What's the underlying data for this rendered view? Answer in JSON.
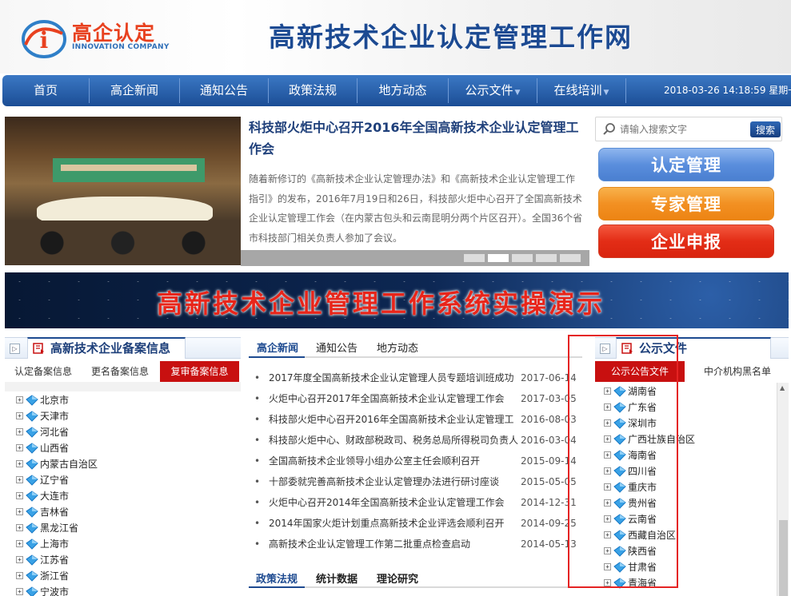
{
  "logo": {
    "name": "高企认定",
    "en": "INNOVATION COMPANY"
  },
  "site_title": "高新技术企业认定管理工作网",
  "nav": {
    "items": [
      {
        "label": "首页",
        "dropdown": false
      },
      {
        "label": "高企新闻",
        "dropdown": false
      },
      {
        "label": "通知公告",
        "dropdown": false
      },
      {
        "label": "政策法规",
        "dropdown": false
      },
      {
        "label": "地方动态",
        "dropdown": false
      },
      {
        "label": "公示文件",
        "dropdown": true
      },
      {
        "label": "在线培训",
        "dropdown": true
      }
    ],
    "datetime": "2018-03-26 14:18:59 星期一"
  },
  "slide": {
    "title": "科技部火炬中心召开2016年全国高新技术企业认定管理工作会",
    "description": "随着新修订的《高新技术企业认定管理办法》和《高新技术企业认定管理工作指引》的发布，2016年7月19日和26日，科技部火炬中心召开了全国高新技术企业认定管理工作会（在内蒙古包头和云南昆明分两个片区召开）。全国36个省市科技部门相关负责人参加了会议。",
    "dots": 5,
    "active_dot": 2
  },
  "search": {
    "placeholder": "请输入搜索文字",
    "button": "搜索"
  },
  "big_buttons": {
    "rd": "认定管理",
    "zj": "专家管理",
    "qy": "企业申报"
  },
  "banner": {
    "title": "高新技术企业管理工作系统实操演示"
  },
  "left_panel": {
    "title": "高新技术企业备案信息",
    "subtabs": [
      "认定备案信息",
      "更名备案信息",
      "复审备案信息"
    ],
    "active_subtab": 2,
    "items": [
      "北京市",
      "天津市",
      "河北省",
      "山西省",
      "内蒙古自治区",
      "辽宁省",
      "大连市",
      "吉林省",
      "黑龙江省",
      "上海市",
      "江苏省",
      "浙江省",
      "宁波市"
    ]
  },
  "news": {
    "tabs": [
      "高企新闻",
      "通知公告",
      "地方动态"
    ],
    "items": [
      {
        "title": "2017年度全国高新技术企业认定管理人员专题培训班成功",
        "date": "2017-06-14"
      },
      {
        "title": "火炬中心召开2017年全国高新技术企业认定管理工作会",
        "date": "2017-03-05"
      },
      {
        "title": "科技部火炬中心召开2016年全国高新技术企业认定管理工",
        "date": "2016-08-03"
      },
      {
        "title": "科技部火炬中心、财政部税政司、税务总局所得税司负责人",
        "date": "2016-03-04"
      },
      {
        "title": "全国高新技术企业领导小组办公室主任会顺利召开",
        "date": "2015-09-14"
      },
      {
        "title": "十部委就完善高新技术企业认定管理办法进行研讨座谈",
        "date": "2015-05-05"
      },
      {
        "title": "火炬中心召开2014年全国高新技术企业认定管理工作会",
        "date": "2014-12-31"
      },
      {
        "title": "2014年国家火炬计划重点高新技术企业评选会顺利召开",
        "date": "2014-09-25"
      },
      {
        "title": "高新技术企业认定管理工作第二批重点检查启动",
        "date": "2014-05-13"
      }
    ],
    "sub_tabs": [
      "政策法规",
      "统计数据",
      "理论研究"
    ]
  },
  "right_panel": {
    "title": "公示文件",
    "subtabs": [
      "公示公告文件",
      "中介机构黑名单"
    ],
    "active_subtab": 0,
    "items": [
      "湖南省",
      "广东省",
      "深圳市",
      "广西壮族自治区",
      "海南省",
      "四川省",
      "重庆市",
      "贵州省",
      "云南省",
      "西藏自治区",
      "陕西省",
      "甘肃省",
      "青海省"
    ]
  },
  "colors": {
    "nav": "#1b4d95",
    "accent_red": "#c81010",
    "highlight": "#e52323"
  }
}
